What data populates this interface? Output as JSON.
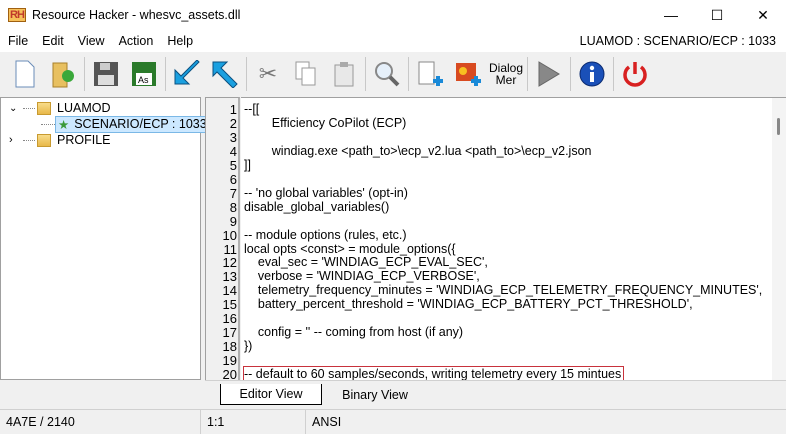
{
  "window": {
    "title": "Resource Hacker - whesvc_assets.dll",
    "logo": "RH"
  },
  "menu": [
    "File",
    "Edit",
    "View",
    "Action",
    "Help"
  ],
  "resource_path": "LUAMOD : SCENARIO/ECP : 1033",
  "toolbar": {
    "dialog_menu_label_1": "Dialog",
    "dialog_menu_label_2": "Mer"
  },
  "tree": {
    "items": [
      {
        "label": "LUAMOD"
      },
      {
        "label": "SCENARIO/ECP : 1033"
      },
      {
        "label": "PROFILE"
      }
    ]
  },
  "editor": {
    "lines": [
      "--[[",
      "        Efficiency CoPilot (ECP)",
      "",
      "        windiag.exe <path_to>\\ecp_v2.lua <path_to>\\ecp_v2.json",
      "]]",
      "",
      "-- 'no global variables' (opt-in)",
      "disable_global_variables()",
      "",
      "-- module options (rules, etc.)",
      "local opts <const> = module_options({",
      "    eval_sec = 'WINDIAG_ECP_EVAL_SEC',",
      "    verbose = 'WINDIAG_ECP_VERBOSE',",
      "    telemetry_frequency_minutes = 'WINDIAG_ECP_TELEMETRY_FREQUENCY_MINUTES',",
      "    battery_percent_threshold = 'WINDIAG_ECP_BATTERY_PCT_THRESHOLD',",
      "",
      "    config = '' -- coming from host (if any)",
      "})",
      "",
      "-- default to 60 samples/seconds, writing telemetry every 15 mintues"
    ],
    "highlighted_line": 20
  },
  "tabs": [
    "Editor View",
    "Binary View"
  ],
  "status": {
    "offset": "4A7E / 2140",
    "position": "1:1",
    "encoding": "ANSI"
  }
}
